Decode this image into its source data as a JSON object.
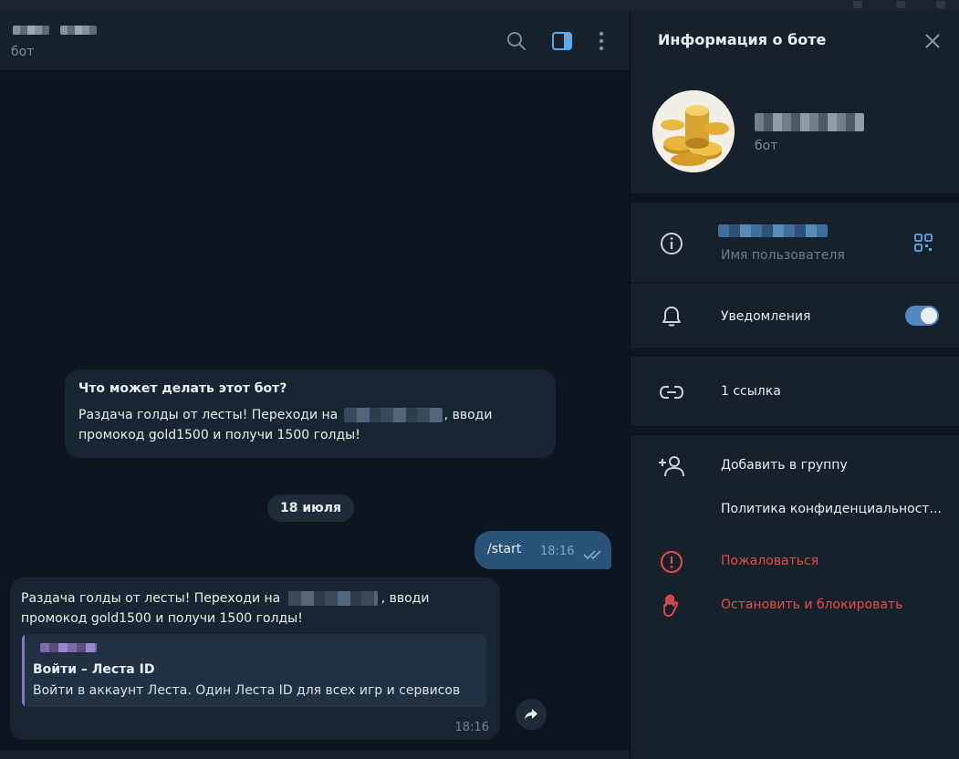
{
  "chat": {
    "subtitle": "бот",
    "bot_info": {
      "title": "Что может делать этот бот?",
      "text_before": "Раздача голды от лесты! Переходи на",
      "text_after_1": ", вводи",
      "text_line2": "промокод gold1500 и получи 1500 голды!"
    },
    "date_divider": "18 июля",
    "outgoing": {
      "text": "/start",
      "time": "18:16"
    },
    "incoming": {
      "text_before": "Раздача голды от лесты! Переходи на",
      "text_after_1": ", вводи",
      "text_line2": "промокод gold1500 и получи 1500 голды!",
      "preview_title": "Войти – Леста ID",
      "preview_desc": "Войти в аккаунт Леста. Один Леста ID для всех игр и сервисов",
      "time": "18:16"
    }
  },
  "info_panel": {
    "title": "Информация о боте",
    "bot_subtitle": "бот",
    "username_caption": "Имя пользователя",
    "notifications_label": "Уведомления",
    "notifications_on": true,
    "links_label": "1 ссылка",
    "add_to_group_label": "Добавить в группу",
    "privacy_label": "Политика конфиденциальност...",
    "report_label": "Пожаловаться",
    "block_label": "Остановить и блокировать"
  },
  "colors": {
    "accent": "#5288c1",
    "danger": "#e34c4c",
    "outgoing_bubble": "#2b5278",
    "incoming_bubble": "#182533"
  },
  "icons": [
    "search-icon",
    "sidebar-toggle-icon",
    "more-vertical-icon",
    "close-icon",
    "info-icon",
    "qr-code-icon",
    "bell-icon",
    "link-icon",
    "add-user-icon",
    "report-icon",
    "block-hand-icon",
    "share-icon",
    "double-check-icon"
  ]
}
